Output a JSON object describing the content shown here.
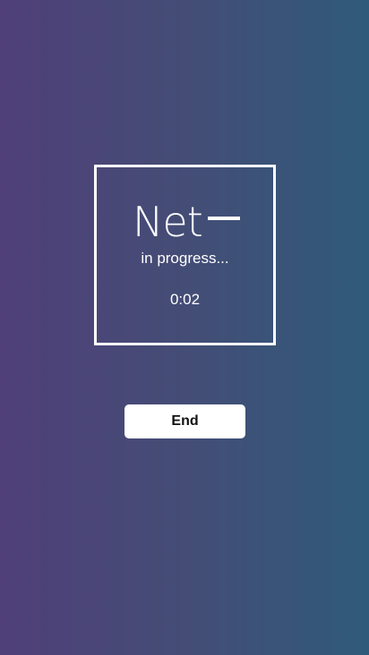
{
  "logo": {
    "text": "Net"
  },
  "status": {
    "progress_text": "in progress...",
    "timer": "0:02"
  },
  "actions": {
    "end_label": "End"
  },
  "colors": {
    "gradient_left": "#503f79",
    "gradient_right": "#2f5a7a",
    "foreground": "#ffffff",
    "button_text": "#111111"
  }
}
